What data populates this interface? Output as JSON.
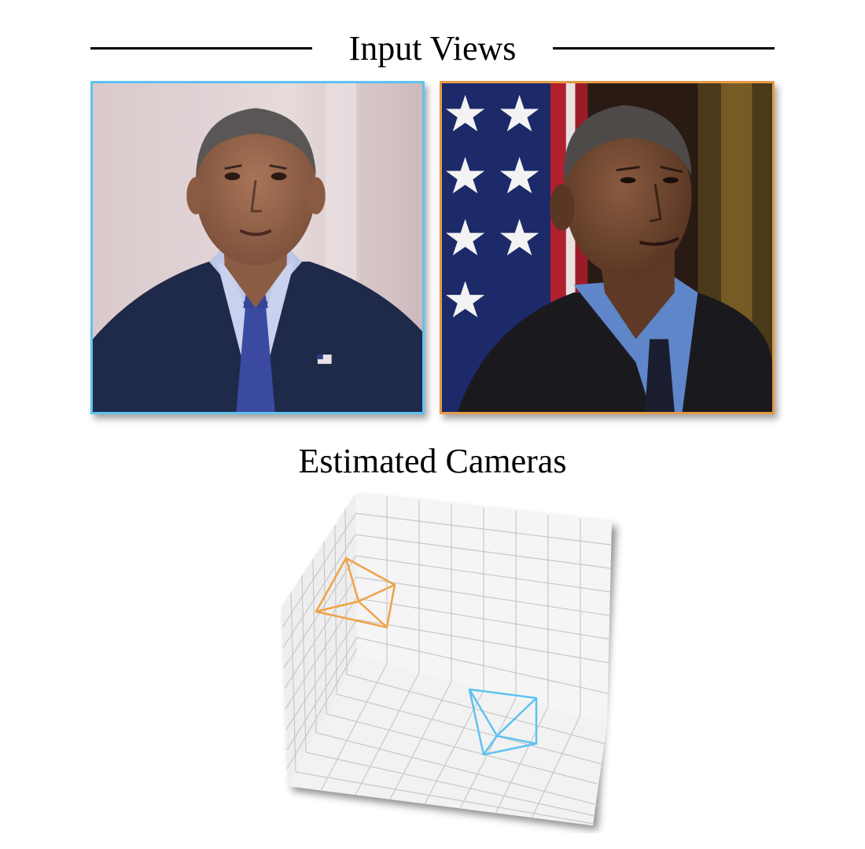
{
  "header": {
    "title": "Input Views"
  },
  "views": [
    {
      "id": "view-1",
      "border_color": "#5ec3f0",
      "alt": "front-facing portrait"
    },
    {
      "id": "view-2",
      "border_color": "#e69a44",
      "alt": "three-quarter portrait"
    }
  ],
  "section": {
    "subtitle": "Estimated Cameras"
  },
  "cameras": [
    {
      "name": "camera-view-2",
      "color": "#f0a24a"
    },
    {
      "name": "camera-view-1",
      "color": "#5ec3f0"
    }
  ]
}
